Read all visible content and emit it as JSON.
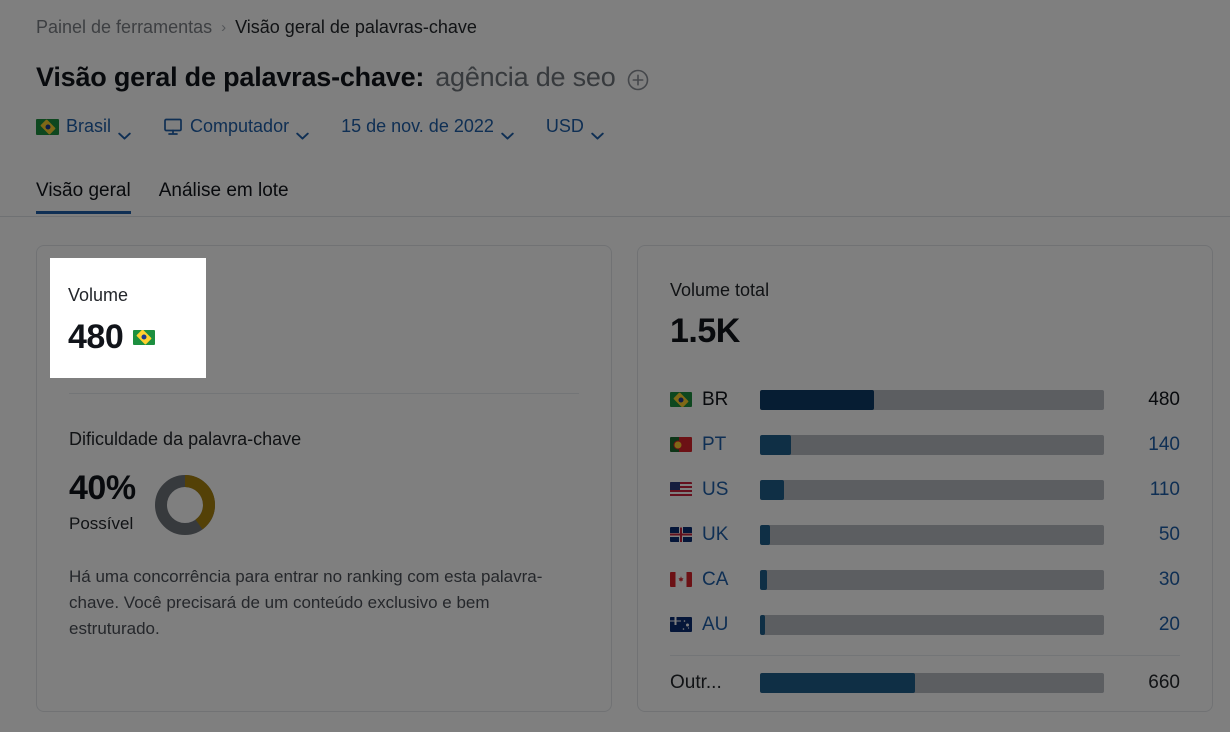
{
  "breadcrumb": {
    "root": "Painel de ferramentas",
    "separator": "›",
    "current": "Visão geral de palavras-chave"
  },
  "header": {
    "title": "Visão geral de palavras-chave:",
    "keyword": "agência de seo",
    "add_icon": "plus-circle-icon"
  },
  "filters": [
    {
      "id": "country",
      "label": "Brasil",
      "icon": "flag-br-icon",
      "chevron": "chevron-down-icon"
    },
    {
      "id": "device",
      "label": "Computador",
      "icon": "desktop-icon",
      "chevron": "chevron-down-icon"
    },
    {
      "id": "date",
      "label": "15 de nov. de 2022",
      "icon": "",
      "chevron": "chevron-down-icon"
    },
    {
      "id": "currency",
      "label": "USD",
      "icon": "",
      "chevron": "chevron-down-icon"
    }
  ],
  "tabs": [
    {
      "label": "Visão geral",
      "active": true
    },
    {
      "label": "Análise em lote",
      "active": false
    }
  ],
  "left_card": {
    "volume_label": "Volume",
    "volume_value": "480",
    "volume_flag": "flag-br-icon",
    "kd_title": "Dificuldade da palavra-chave",
    "kd_percent": "40%",
    "kd_status": "Possível",
    "kd_description": "Há uma concorrência para entrar no ranking com esta palavra-chave. Você precisará de um conteúdo exclusivo e bem estruturado."
  },
  "right_card": {
    "total_label": "Volume total",
    "total_value": "1.5K",
    "rows": [
      {
        "code": "BR",
        "flag": "flag-br-icon",
        "value": "480",
        "fill_pct": 33,
        "primary": true
      },
      {
        "code": "PT",
        "flag": "flag-pt-icon",
        "value": "140",
        "fill_pct": 9,
        "primary": false
      },
      {
        "code": "US",
        "flag": "flag-us-icon",
        "value": "110",
        "fill_pct": 7,
        "primary": false
      },
      {
        "code": "UK",
        "flag": "flag-uk-icon",
        "value": "50",
        "fill_pct": 3,
        "primary": false
      },
      {
        "code": "CA",
        "flag": "flag-ca-icon",
        "value": "30",
        "fill_pct": 2,
        "primary": false
      },
      {
        "code": "AU",
        "flag": "flag-au-icon",
        "value": "20",
        "fill_pct": 1.5,
        "primary": false
      }
    ],
    "other_row": {
      "code": "Outr...",
      "value": "660",
      "fill_pct": 45
    }
  },
  "chart_data": {
    "type": "bar",
    "title": "Volume total",
    "total": "1.5K",
    "categories": [
      "BR",
      "PT",
      "US",
      "UK",
      "CA",
      "AU",
      "Outr..."
    ],
    "values": [
      480,
      140,
      110,
      50,
      30,
      20,
      660
    ],
    "ylabel": "",
    "xlabel": "",
    "orientation": "horizontal",
    "grid": false,
    "legend": false
  },
  "colors": {
    "accent_blue": "#1f5fa8",
    "bar_primary": "#0d3b66",
    "bar_secondary": "#1f5f8b",
    "bar_track": "#b8bcc2",
    "kd_gold": "#a8830f",
    "kd_gray": "#6f747b"
  }
}
